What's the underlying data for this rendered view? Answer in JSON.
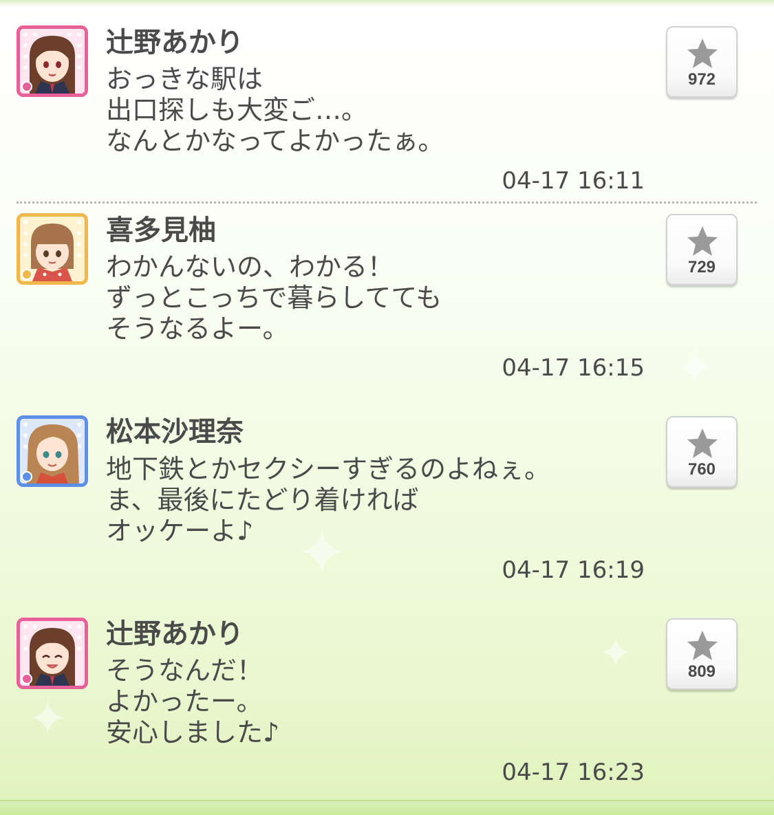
{
  "posts": [
    {
      "name": "辻野あかり",
      "lines": [
        "おっきな駅は",
        "出口探しも大変ご…。",
        "なんとかなってよかったぁ。"
      ],
      "time": "04-17 16:11",
      "likes": "972",
      "avatar_frame": "#e8609a",
      "avatar_icon": "flower-icon"
    },
    {
      "name": "喜多見柚",
      "lines": [
        "わかんないの、わかる！",
        "ずっとこっちで暮らしてても",
        "そうなるよー。"
      ],
      "time": "04-17 16:15",
      "likes": "729",
      "avatar_frame": "#f2b74a",
      "avatar_icon": "sun-icon"
    },
    {
      "name": "松本沙理奈",
      "lines": [
        "地下鉄とかセクシーすぎるのよねぇ。",
        "ま、最後にたどり着ければ",
        "オッケーよ♪"
      ],
      "time": "04-17 16:19",
      "likes": "760",
      "avatar_frame": "#5c8fe6",
      "avatar_icon": "diamond-icon"
    },
    {
      "name": "辻野あかり",
      "lines": [
        "そうなんだ！",
        "よかったー。",
        "安心しました♪"
      ],
      "time": "04-17 16:23",
      "likes": "809",
      "avatar_frame": "#e8609a",
      "avatar_icon": "flower-icon"
    }
  ],
  "colors": {
    "text": "#4a4a4a",
    "background_bottom": "#dff2bb",
    "star": "#9a9a9a",
    "cute_frame": "#e8609a",
    "passion_frame": "#f2b74a",
    "cool_frame": "#5c8fe6"
  }
}
